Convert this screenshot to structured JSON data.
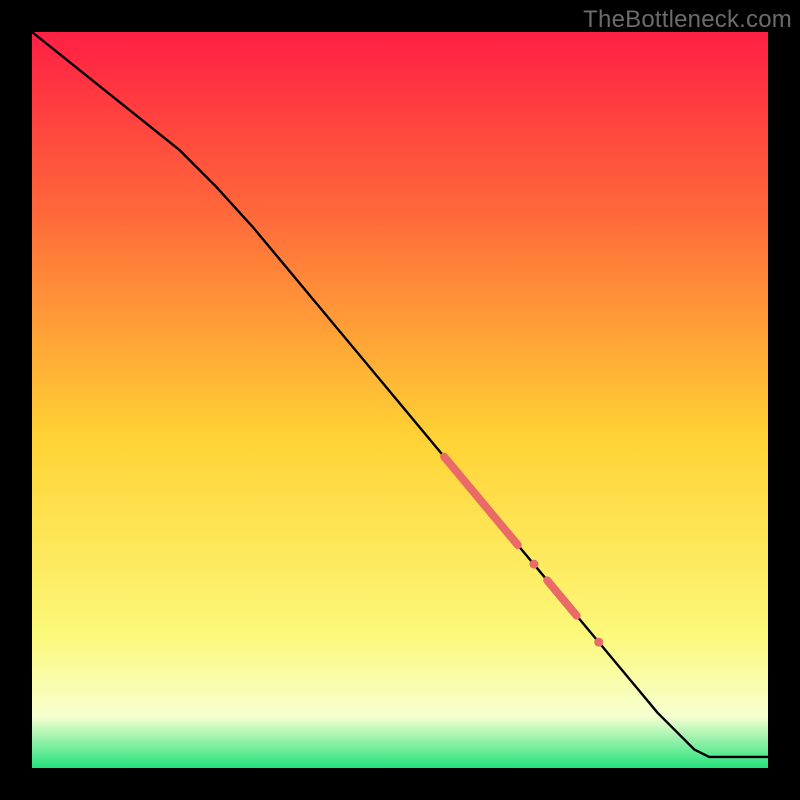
{
  "watermark": "TheBottleneck.com",
  "colors": {
    "gradient_top": "#ff1f44",
    "gradient_mid_upper": "#ff6a3a",
    "gradient_mid": "#ffd234",
    "gradient_yellow_light": "#fcf97a",
    "gradient_pale": "#f7ffd0",
    "gradient_green": "#23e27c",
    "line": "#000000",
    "marker": "#e96a67"
  },
  "chart_data": {
    "type": "line",
    "title": "",
    "xlabel": "",
    "ylabel": "",
    "xlim": [
      0,
      100
    ],
    "ylim": [
      0,
      100
    ],
    "series": [
      {
        "name": "curve",
        "x": [
          0,
          5,
          10,
          15,
          20,
          25,
          30,
          35,
          40,
          45,
          50,
          55,
          60,
          65,
          70,
          75,
          80,
          85,
          90,
          92,
          95,
          100
        ],
        "y": [
          100,
          96,
          92,
          88,
          84,
          79,
          73.5,
          67.5,
          61.5,
          55.5,
          49.5,
          43.5,
          37.5,
          31.5,
          25.5,
          19.5,
          13.5,
          7.5,
          2.5,
          1.5,
          1.5,
          1.5
        ]
      }
    ],
    "markers": [
      {
        "type": "segment",
        "x0": 56,
        "y0": 42.3,
        "x1": 66,
        "y1": 30.3,
        "w": 8
      },
      {
        "type": "dot",
        "x": 68.2,
        "y": 27.7,
        "r": 4.5
      },
      {
        "type": "segment",
        "x0": 70,
        "y0": 25.5,
        "x1": 74,
        "y1": 20.7,
        "w": 8
      },
      {
        "type": "dot",
        "x": 77,
        "y": 17.1,
        "r": 4.5
      }
    ]
  }
}
